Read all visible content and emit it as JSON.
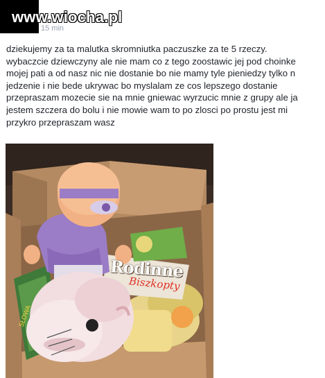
{
  "header": {
    "watermark": "www.wiocha.pl",
    "timestamp": "15 min"
  },
  "post": {
    "text_lines": [
      "dziekujemy za ta malutka skromniutka paczuszke za te 5 rzeczy.",
      "wybaczcie dziewczyny ale nie mam co z tego zoostawic jej pod choinke",
      "mojej pati a od nasz nic nie dostanie bo nie mamy tyle pieniedzy tylko n",
      "jedzenie i nie bede ukrywac bo myslalam ze cos lepszego dostanie",
      "przepraszam mozecie sie na mnie gniewac wyrzucic mnie z grupy ale ja",
      "jestem szczera do bolu i nie mowie wam to po zlosci po prostu jest mi",
      "przykro przepraszam wasz"
    ]
  },
  "photo": {
    "brand_text": "Rodinne",
    "brand_sub": "Biszkopty"
  }
}
